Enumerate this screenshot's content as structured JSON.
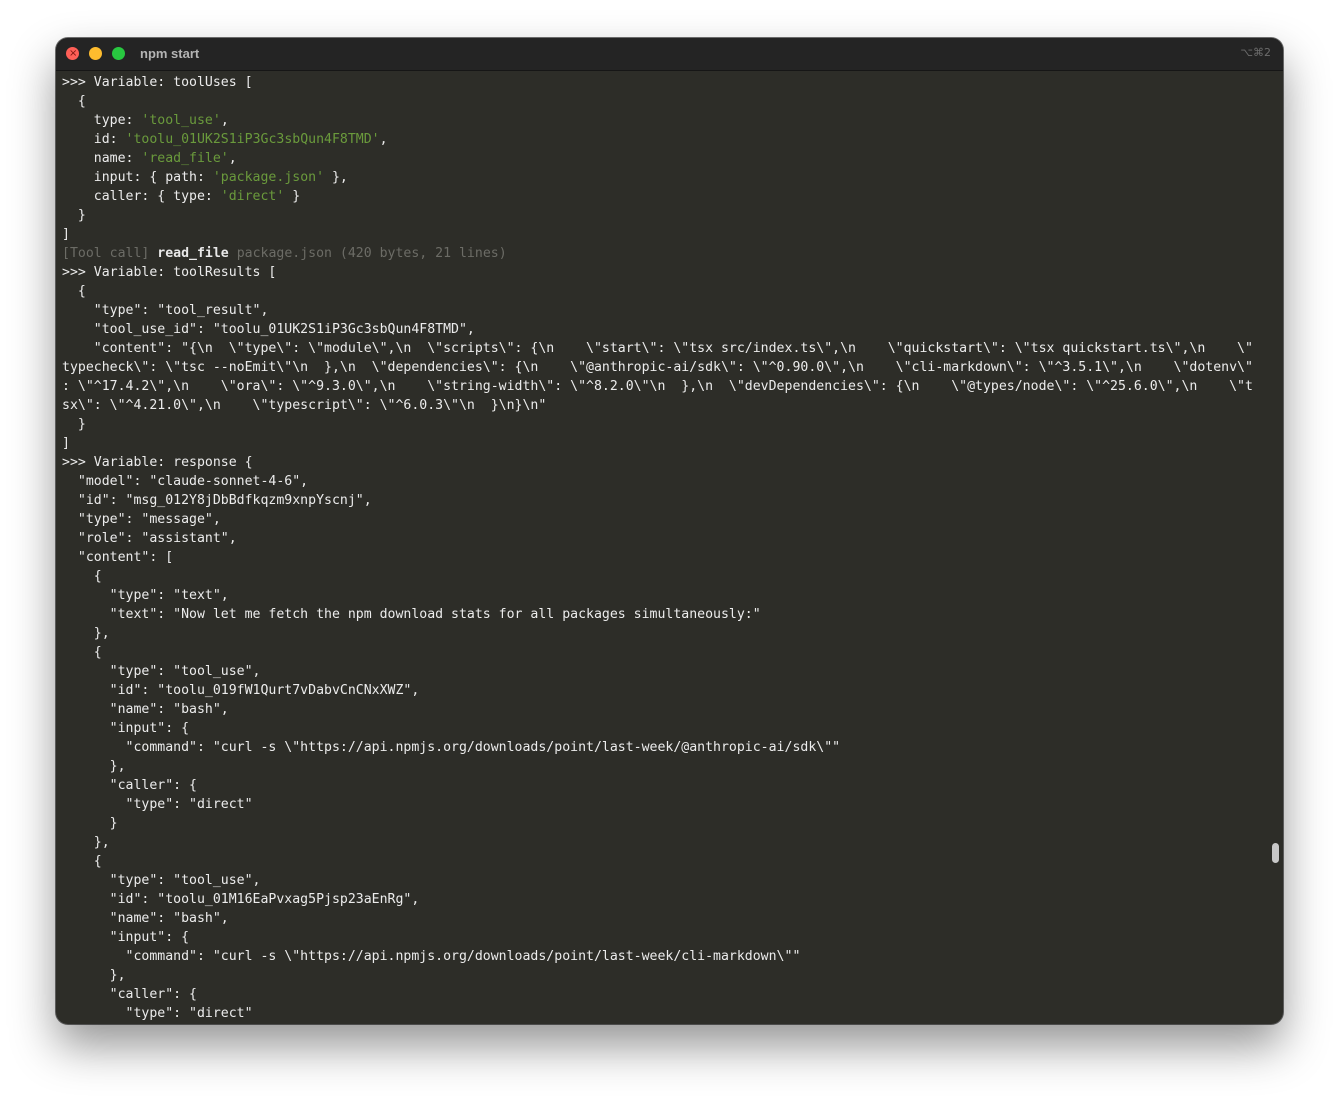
{
  "window": {
    "title": "npm start",
    "shortcut": "⌥⌘2",
    "close_glyph": "×"
  },
  "icons": {
    "close": "close-icon",
    "minimize": "minimize-icon",
    "maximize": "maximize-icon"
  },
  "colors": {
    "background": "#2d2d28",
    "text": "#ececec",
    "string": "#6a9a3c",
    "dim": "#6c6c66"
  },
  "terminal": {
    "lines": [
      [
        {
          "t": ">>> Variable: toolUses ["
        }
      ],
      [
        {
          "t": "  {"
        }
      ],
      [
        {
          "t": "    type: "
        },
        {
          "t": "'tool_use'",
          "c": "str"
        },
        {
          "t": ","
        }
      ],
      [
        {
          "t": "    id: "
        },
        {
          "t": "'toolu_01UK2S1iP3Gc3sbQun4F8TMD'",
          "c": "str"
        },
        {
          "t": ","
        }
      ],
      [
        {
          "t": "    name: "
        },
        {
          "t": "'read_file'",
          "c": "str"
        },
        {
          "t": ","
        }
      ],
      [
        {
          "t": "    input: { path: "
        },
        {
          "t": "'package.json'",
          "c": "str"
        },
        {
          "t": " },"
        }
      ],
      [
        {
          "t": "    caller: { type: "
        },
        {
          "t": "'direct'",
          "c": "str"
        },
        {
          "t": " }"
        }
      ],
      [
        {
          "t": "  }"
        }
      ],
      [
        {
          "t": "]"
        }
      ],
      [
        {
          "t": "[Tool call] ",
          "c": "dim"
        },
        {
          "t": "read_file",
          "c": "bold"
        },
        {
          "t": " package.json (420 bytes, 21 lines)",
          "c": "dim"
        }
      ],
      [
        {
          "t": ">>> Variable: toolResults ["
        }
      ],
      [
        {
          "t": "  {"
        }
      ],
      [
        {
          "t": "    \"type\": \"tool_result\","
        }
      ],
      [
        {
          "t": "    \"tool_use_id\": \"toolu_01UK2S1iP3Gc3sbQun4F8TMD\","
        }
      ],
      [
        {
          "t": "    \"content\": \"{\\n  \\\"type\\\": \\\"module\\\",\\n  \\\"scripts\\\": {\\n    \\\"start\\\": \\\"tsx src/index.ts\\\",\\n    \\\"quickstart\\\": \\\"tsx quickstart.ts\\\",\\n    \\\""
        }
      ],
      [
        {
          "t": "typecheck\\\": \\\"tsc --noEmit\\\"\\n  },\\n  \\\"dependencies\\\": {\\n    \\\"@anthropic-ai/sdk\\\": \\\"^0.90.0\\\",\\n    \\\"cli-markdown\\\": \\\"^3.5.1\\\",\\n    \\\"dotenv\\\""
        }
      ],
      [
        {
          "t": ": \\\"^17.4.2\\\",\\n    \\\"ora\\\": \\\"^9.3.0\\\",\\n    \\\"string-width\\\": \\\"^8.2.0\\\"\\n  },\\n  \\\"devDependencies\\\": {\\n    \\\"@types/node\\\": \\\"^25.6.0\\\",\\n    \\\"t"
        }
      ],
      [
        {
          "t": "sx\\\": \\\"^4.21.0\\\",\\n    \\\"typescript\\\": \\\"^6.0.3\\\"\\n  }\\n}\\n\""
        }
      ],
      [
        {
          "t": "  }"
        }
      ],
      [
        {
          "t": "]"
        }
      ],
      [
        {
          "t": ">>> Variable: response {"
        }
      ],
      [
        {
          "t": "  \"model\": \"claude-sonnet-4-6\","
        }
      ],
      [
        {
          "t": "  \"id\": \"msg_012Y8jDbBdfkqzm9xnpYscnj\","
        }
      ],
      [
        {
          "t": "  \"type\": \"message\","
        }
      ],
      [
        {
          "t": "  \"role\": \"assistant\","
        }
      ],
      [
        {
          "t": "  \"content\": ["
        }
      ],
      [
        {
          "t": "    {"
        }
      ],
      [
        {
          "t": "      \"type\": \"text\","
        }
      ],
      [
        {
          "t": "      \"text\": \"Now let me fetch the npm download stats for all packages simultaneously:\""
        }
      ],
      [
        {
          "t": "    },"
        }
      ],
      [
        {
          "t": "    {"
        }
      ],
      [
        {
          "t": "      \"type\": \"tool_use\","
        }
      ],
      [
        {
          "t": "      \"id\": \"toolu_019fW1Qurt7vDabvCnCNxXWZ\","
        }
      ],
      [
        {
          "t": "      \"name\": \"bash\","
        }
      ],
      [
        {
          "t": "      \"input\": {"
        }
      ],
      [
        {
          "t": "        \"command\": \"curl -s \\\"https://api.npmjs.org/downloads/point/last-week/@anthropic-ai/sdk\\\"\""
        }
      ],
      [
        {
          "t": "      },"
        }
      ],
      [
        {
          "t": "      \"caller\": {"
        }
      ],
      [
        {
          "t": "        \"type\": \"direct\""
        }
      ],
      [
        {
          "t": "      }"
        }
      ],
      [
        {
          "t": "    },"
        }
      ],
      [
        {
          "t": "    {"
        }
      ],
      [
        {
          "t": "      \"type\": \"tool_use\","
        }
      ],
      [
        {
          "t": "      \"id\": \"toolu_01M16EaPvxag5Pjsp23aEnRg\","
        }
      ],
      [
        {
          "t": "      \"name\": \"bash\","
        }
      ],
      [
        {
          "t": "      \"input\": {"
        }
      ],
      [
        {
          "t": "        \"command\": \"curl -s \\\"https://api.npmjs.org/downloads/point/last-week/cli-markdown\\\"\""
        }
      ],
      [
        {
          "t": "      },"
        }
      ],
      [
        {
          "t": "      \"caller\": {"
        }
      ],
      [
        {
          "t": "        \"type\": \"direct\""
        }
      ]
    ]
  }
}
